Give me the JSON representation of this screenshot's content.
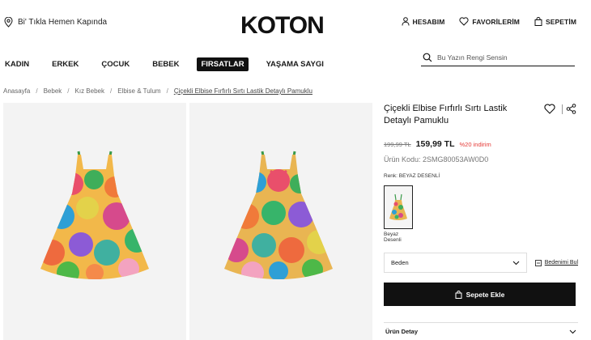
{
  "header": {
    "delivery_text": "Bi' Tıkla Hemen Kapında",
    "logo_text": "KOTON",
    "account_label": "HESABIM",
    "favorites_label": "FAVORİLERİM",
    "cart_label": "SEPETİM"
  },
  "nav": {
    "items": [
      {
        "label": "KADIN"
      },
      {
        "label": "ERKEK"
      },
      {
        "label": "ÇOCUK"
      },
      {
        "label": "BEBEK"
      },
      {
        "label": "FIRSATLAR"
      },
      {
        "label": "YAŞAMA SAYGI"
      }
    ],
    "search_placeholder": "Bu Yazın Rengi Sensin"
  },
  "breadcrumb": {
    "items": [
      "Anasayfa",
      "Bebek",
      "Kız Bebek",
      "Elbise & Tulum",
      "Çiçekli Elbise Fırfırlı Sırtı Lastik Detaylı Pamuklu"
    ]
  },
  "product": {
    "title": "Çiçekli Elbise Fırfırlı Sırtı Lastik Detaylı Pamuklu",
    "old_price": "199,99 TL",
    "price": "159,99 TL",
    "discount": "%20 indirim",
    "sku": "Ürün Kodu: 2SMG80053AW0D0",
    "color_label": "Renk: BEYAZ DESENLİ",
    "swatch_name": "Beyaz Desenli",
    "size_label": "Beden",
    "size_guide_label": "Bedenimi Bul",
    "add_to_cart_label": "Sepete Ekle",
    "details_label": "Ürün Detay"
  },
  "colors": {
    "accent": "#111111",
    "discount": "#e53935",
    "image_bg": "#f3f3f3"
  }
}
